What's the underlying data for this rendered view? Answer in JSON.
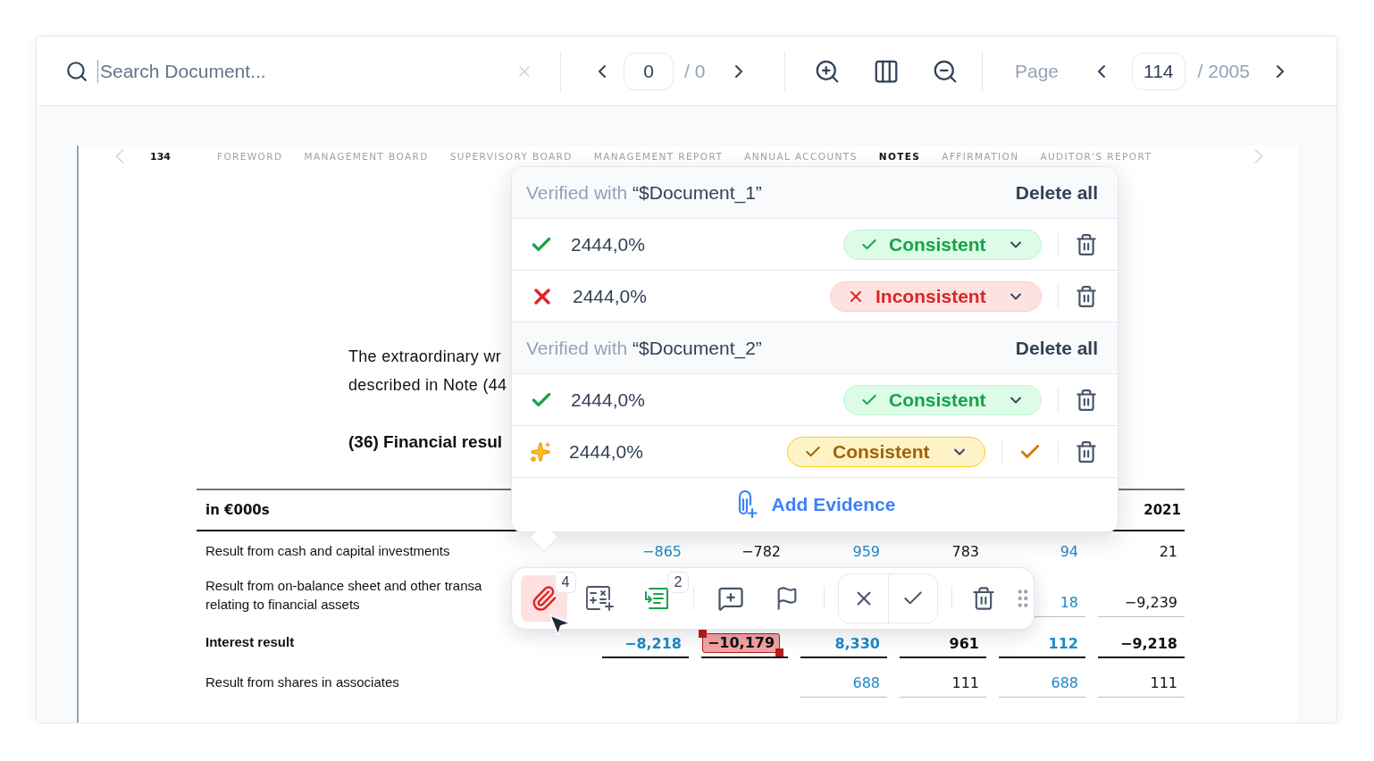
{
  "search": {
    "placeholder": "Search Document..."
  },
  "match_nav": {
    "current": "0",
    "total": "/ 0"
  },
  "page_nav": {
    "label": "Page",
    "current": "114",
    "total": "/ 2005"
  },
  "document": {
    "page_number": "134",
    "sections": [
      {
        "label": "FOREWORD",
        "selected": false
      },
      {
        "label": "MANAGEMENT BOARD",
        "selected": false
      },
      {
        "label": "SUPERVISORY BOARD",
        "selected": false
      },
      {
        "label": "MANAGEMENT REPORT",
        "selected": false
      },
      {
        "label": "ANNUAL ACCOUNTS",
        "selected": false
      },
      {
        "label": "NOTES",
        "selected": true
      },
      {
        "label": "AFFIRMATION",
        "selected": false
      },
      {
        "label": "AUDITOR'S REPORT",
        "selected": false
      }
    ],
    "paragraph": [
      "The extraordinary wr",
      "described in Note (44"
    ],
    "heading": "(36) Financial resul",
    "table": {
      "header": {
        "label": "in €000s",
        "cells": {
          "column_6": "2021"
        }
      },
      "rows": [
        {
          "label": [
            "Result from cash and capital investments"
          ],
          "bold": false,
          "cells": {
            "column_1": {
              "text": "−865",
              "linked": true,
              "flagged": false
            },
            "column_2": {
              "text": "−782",
              "linked": false,
              "flagged": false
            },
            "column_3": {
              "text": "959",
              "linked": true,
              "flagged": false
            },
            "column_4": {
              "text": "783",
              "linked": false,
              "flagged": false
            },
            "column_5": {
              "text": "94",
              "linked": true,
              "flagged": false
            },
            "column_6": {
              "text": "21",
              "linked": false,
              "flagged": false
            }
          }
        },
        {
          "label": [
            "Result from on-balance sheet and other transa",
            "relating to financial assets"
          ],
          "bold": false,
          "cells": {
            "column_5": {
              "text": "18",
              "linked": true,
              "flagged": false
            },
            "column_6": {
              "text": "−9,239",
              "linked": false,
              "flagged": false
            }
          }
        },
        {
          "label": [
            "Interest result"
          ],
          "bold": true,
          "cells": {
            "column_1": {
              "text": "−8,218",
              "linked": true,
              "flagged": false
            },
            "column_2": {
              "text": "−10,179",
              "linked": false,
              "flagged": true
            },
            "column_3": {
              "text": "8,330",
              "linked": true,
              "flagged": false
            },
            "column_4": {
              "text": "961",
              "linked": false,
              "flagged": false
            },
            "column_5": {
              "text": "112",
              "linked": true,
              "flagged": false
            },
            "column_6": {
              "text": "−9,218",
              "linked": false,
              "flagged": false
            }
          }
        },
        {
          "label": [
            "Result from shares in associates"
          ],
          "bold": false,
          "cells": {
            "column_3": {
              "text": "688",
              "linked": true,
              "flagged": false
            },
            "column_4": {
              "text": "111",
              "linked": false,
              "flagged": false
            },
            "column_5": {
              "text": "688",
              "linked": true,
              "flagged": false
            },
            "column_6": {
              "text": "111",
              "linked": false,
              "flagged": false
            }
          }
        }
      ]
    }
  },
  "verification": {
    "groups": [
      {
        "prefix": "Verified with",
        "source": "“$Document_1”",
        "action": "Delete all",
        "items": [
          {
            "kind": "check",
            "value": "2444,0%",
            "verdict": {
              "label": "Consistent",
              "kind": "consistent"
            },
            "confirm": false
          },
          {
            "kind": "cross",
            "value": "2444,0%",
            "verdict": {
              "label": "Inconsistent",
              "kind": "inconsistent"
            },
            "confirm": false
          }
        ]
      },
      {
        "prefix": "Verified with",
        "source": "“$Document_2”",
        "action": "Delete all",
        "items": [
          {
            "kind": "check",
            "value": "2444,0%",
            "verdict": {
              "label": "Consistent",
              "kind": "consistent"
            },
            "confirm": false
          },
          {
            "kind": "sparkle",
            "value": "2444,0%",
            "verdict": {
              "label": "Consistent",
              "kind": "suggested"
            },
            "confirm": true
          }
        ]
      }
    ],
    "footer": "Add Evidence"
  },
  "toolbar": {
    "tools": [
      {
        "kind": "attach",
        "badge": "4",
        "selected": true
      },
      {
        "kind": "formula",
        "selected": false
      },
      {
        "kind": "linked-list",
        "badge": "2",
        "selected": false
      },
      {
        "kind": "comment",
        "selected": false
      },
      {
        "kind": "flag",
        "selected": false
      }
    ],
    "decisions": [
      {
        "kind": "reject"
      },
      {
        "kind": "accept"
      }
    ]
  }
}
